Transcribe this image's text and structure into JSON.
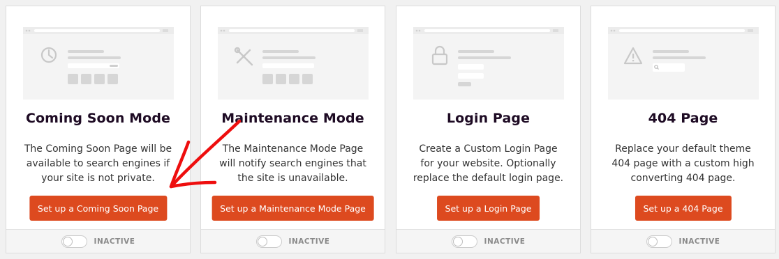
{
  "colors": {
    "accent": "#dd4a1f",
    "title": "#1e0b24",
    "annotation_arrow": "#ee0e0e",
    "placeholder": "#dedede"
  },
  "cards": [
    {
      "title": "Coming Soon Mode",
      "description": "The Coming Soon Page will be available to search engines if your site is not private.",
      "button_label": "Set up a Coming Soon Page",
      "status": "INACTIVE",
      "toggle_on": false,
      "icon": "clock-icon"
    },
    {
      "title": "Maintenance Mode",
      "description": "The Maintenance Mode Page will notify search engines that the site is unavailable.",
      "button_label": "Set up a Maintenance Mode Page",
      "status": "INACTIVE",
      "toggle_on": false,
      "icon": "tools-icon"
    },
    {
      "title": "Login Page",
      "description": "Create a Custom Login Page for your website. Optionally replace the default login page.",
      "button_label": "Set up a Login Page",
      "status": "INACTIVE",
      "toggle_on": false,
      "icon": "lock-icon"
    },
    {
      "title": "404 Page",
      "description": "Replace your default theme 404 page with a custom high converting 404 page.",
      "button_label": "Set up a 404 Page",
      "status": "INACTIVE",
      "toggle_on": false,
      "icon": "warning-icon"
    }
  ]
}
